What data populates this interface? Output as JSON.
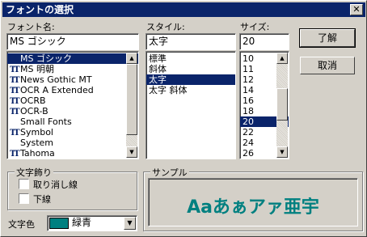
{
  "title": "フォントの選択",
  "font": {
    "label": "フォント名:",
    "value": "MS ゴシック",
    "items": [
      {
        "name": "MS ゴシック",
        "tt": true
      },
      {
        "name": "MS 明朝",
        "tt": true
      },
      {
        "name": "News Gothic MT",
        "tt": true
      },
      {
        "name": "OCR A Extended",
        "tt": true
      },
      {
        "name": "OCRB",
        "tt": true
      },
      {
        "name": "OCR-B",
        "tt": true
      },
      {
        "name": "Small Fonts",
        "tt": false
      },
      {
        "name": "Symbol",
        "tt": true
      },
      {
        "name": "System",
        "tt": false
      },
      {
        "name": "Tahoma",
        "tt": true
      }
    ],
    "selected_index": 0
  },
  "style": {
    "label": "スタイル:",
    "value": "太字",
    "items": [
      "標準",
      "斜体",
      "太字",
      "太字 斜体"
    ],
    "selected_index": 2
  },
  "size": {
    "label": "サイズ:",
    "value": "20",
    "items": [
      "10",
      "11",
      "12",
      "14",
      "16",
      "18",
      "20",
      "22",
      "24",
      "26"
    ],
    "selected_index": 6
  },
  "buttons": {
    "ok": "了解",
    "cancel": "取消"
  },
  "effects": {
    "title": "文字飾り",
    "strikeout": "取り消し線",
    "underline": "下線"
  },
  "color": {
    "label": "文字色",
    "value": "緑青",
    "swatch": "#008080"
  },
  "sample": {
    "title": "サンプル",
    "text": "Aaあぁアァ亜宇"
  },
  "icons": {
    "close": "close-icon",
    "tt": "truetype-icon",
    "up": "arrow-up-icon",
    "down": "arrow-down-icon"
  }
}
